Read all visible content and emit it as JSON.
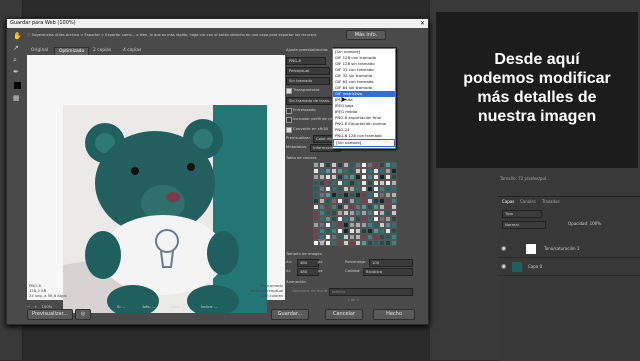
{
  "dialog": {
    "title": "Guardar para Web (100%)",
    "close": "✕",
    "info": "Sugerencias útiles Archivo > Exportar > Exportar como... o bien, lo que es más rápido, haga clic con el botón derecho en una capa para exportar los recursos",
    "more_info": "Más info.",
    "tabs": [
      "Original",
      "Optimizado",
      "2 copias",
      "4 copias"
    ],
    "preset_label": "Ajuste preestablecido:",
    "preset_value": "[Sin nombre]",
    "format": "PNG-8",
    "reduction": "Perceptual",
    "dither": "Sin tramado",
    "transparency_label": "Transparencia",
    "transparency_dither": "Sin tramado de trans...",
    "interlaced_label": "Entrelazado",
    "embed_profile_label": "Incrustar perfil de co...",
    "convert_srgb_label": "Convertir en sRGB",
    "preview_label": "Previsualizar:",
    "preview_value": "Color de m...",
    "metadata_label": "Metadatos:",
    "metadata_value": "Información...",
    "color_table_label": "Tabla de colores",
    "colors_count": "256",
    "image_size_label": "Tamaño de imagen",
    "width_label": "An:",
    "width_value": "480",
    "height_label": "Al:",
    "height_value": "480",
    "px": "px",
    "percent_label": "Porcentaje:",
    "percent_value": "100",
    "quality_label": "Calidad:",
    "quality_value": "Bicúbica",
    "animation_label": "Animación",
    "loop_label": "Opciones de bucle:",
    "loop_value": "Infinito",
    "frame_counter": "1 de 1",
    "stats_left": [
      "PNG-8",
      "128,2 KB",
      "24 seg. a 56,6 Kbps"
    ],
    "stats_right": [
      "0% tramado",
      "Paleta Perceptual",
      "256 colores"
    ],
    "zoom": "100%",
    "readouts": [
      "R: --",
      "G: --",
      "B: --",
      "Alfa: --",
      "Hex: --",
      "Índice: --"
    ],
    "preview_button": "Previsualizar...",
    "save_button": "Guardar...",
    "cancel_button": "Cancelar",
    "done_button": "Hecho"
  },
  "dropdown_items": [
    {
      "label": "[Sin nombre]",
      "selected": false
    },
    {
      "label": "GIF 128 con tramado",
      "selected": false
    },
    {
      "label": "GIF 128 sin tramado",
      "selected": false
    },
    {
      "label": "GIF 32 con tramado",
      "selected": false
    },
    {
      "label": "GIF 32 sin tramado",
      "selected": false
    },
    {
      "label": "GIF 64 con tramado",
      "selected": false
    },
    {
      "label": "GIF 64 sin tramado",
      "selected": false
    },
    {
      "label": "GIF restrictivo",
      "selected": true
    },
    {
      "label": "JPEG alta",
      "selected": false
    },
    {
      "label": "JPEG baja",
      "selected": false
    },
    {
      "label": "JPEG media",
      "selected": false
    },
    {
      "label": "PNG-8 exportación final",
      "selected": false
    },
    {
      "label": "PNG-8 Exportación normal",
      "selected": false
    },
    {
      "label": "PNG-24",
      "selected": false
    },
    {
      "label": "PNG-8 128 con tramado",
      "selected": false
    },
    {
      "label": "[Sin nombre]",
      "selected": false
    }
  ],
  "overlay": {
    "lines": [
      "Desde aquí",
      "podemos modificar",
      "más detalles de",
      "nuestra imagen"
    ]
  },
  "ps_panels": {
    "tabs": [
      "Capas",
      "Canales",
      "Trazados"
    ],
    "kind": "Tipo",
    "mode": "Normal",
    "opacity": "Opacidad: 100%",
    "layers": [
      "Tono/saturación 1",
      "Capa 0"
    ],
    "top_readout": "Tamaño: 72 píxeles/pul..."
  },
  "colors": {
    "teal": "#1f5f5e",
    "selection_blue": "#2d71d6",
    "overlay_bg": "#1c1c1c"
  }
}
